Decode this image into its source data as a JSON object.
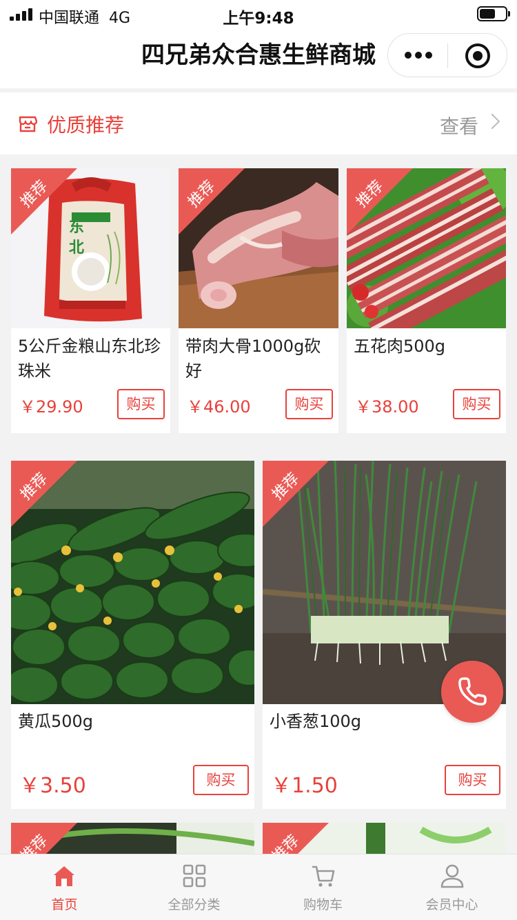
{
  "status_bar": {
    "carrier": "中国联通",
    "network": "4G",
    "time": "上午9:48"
  },
  "nav": {
    "title": "四兄弟众合惠生鲜商城"
  },
  "section": {
    "title": "优质推荐",
    "more": "查看"
  },
  "badge": "推荐",
  "products": [
    {
      "name": "5公斤金粮山东北珍珠米",
      "price": "￥29.90",
      "buy": "购买"
    },
    {
      "name": "带肉大骨1000g砍好",
      "price": "￥46.00",
      "buy": "购买"
    },
    {
      "name": "五花肉500g",
      "price": "￥38.00",
      "buy": "购买"
    },
    {
      "name": "黄瓜500g",
      "price": "￥3.50",
      "buy": "购买"
    },
    {
      "name": "小香葱100g",
      "price": "￥1.50",
      "buy": "购买"
    }
  ],
  "tabbar": [
    {
      "label": "首页",
      "icon": "home-icon",
      "active": true
    },
    {
      "label": "全部分类",
      "icon": "grid-icon",
      "active": false
    },
    {
      "label": "购物车",
      "icon": "cart-icon",
      "active": false
    },
    {
      "label": "会员中心",
      "icon": "user-icon",
      "active": false
    }
  ],
  "colors": {
    "accent": "#e8413b",
    "ribbon": "#ea5a55",
    "background": "#f2f2f2"
  }
}
